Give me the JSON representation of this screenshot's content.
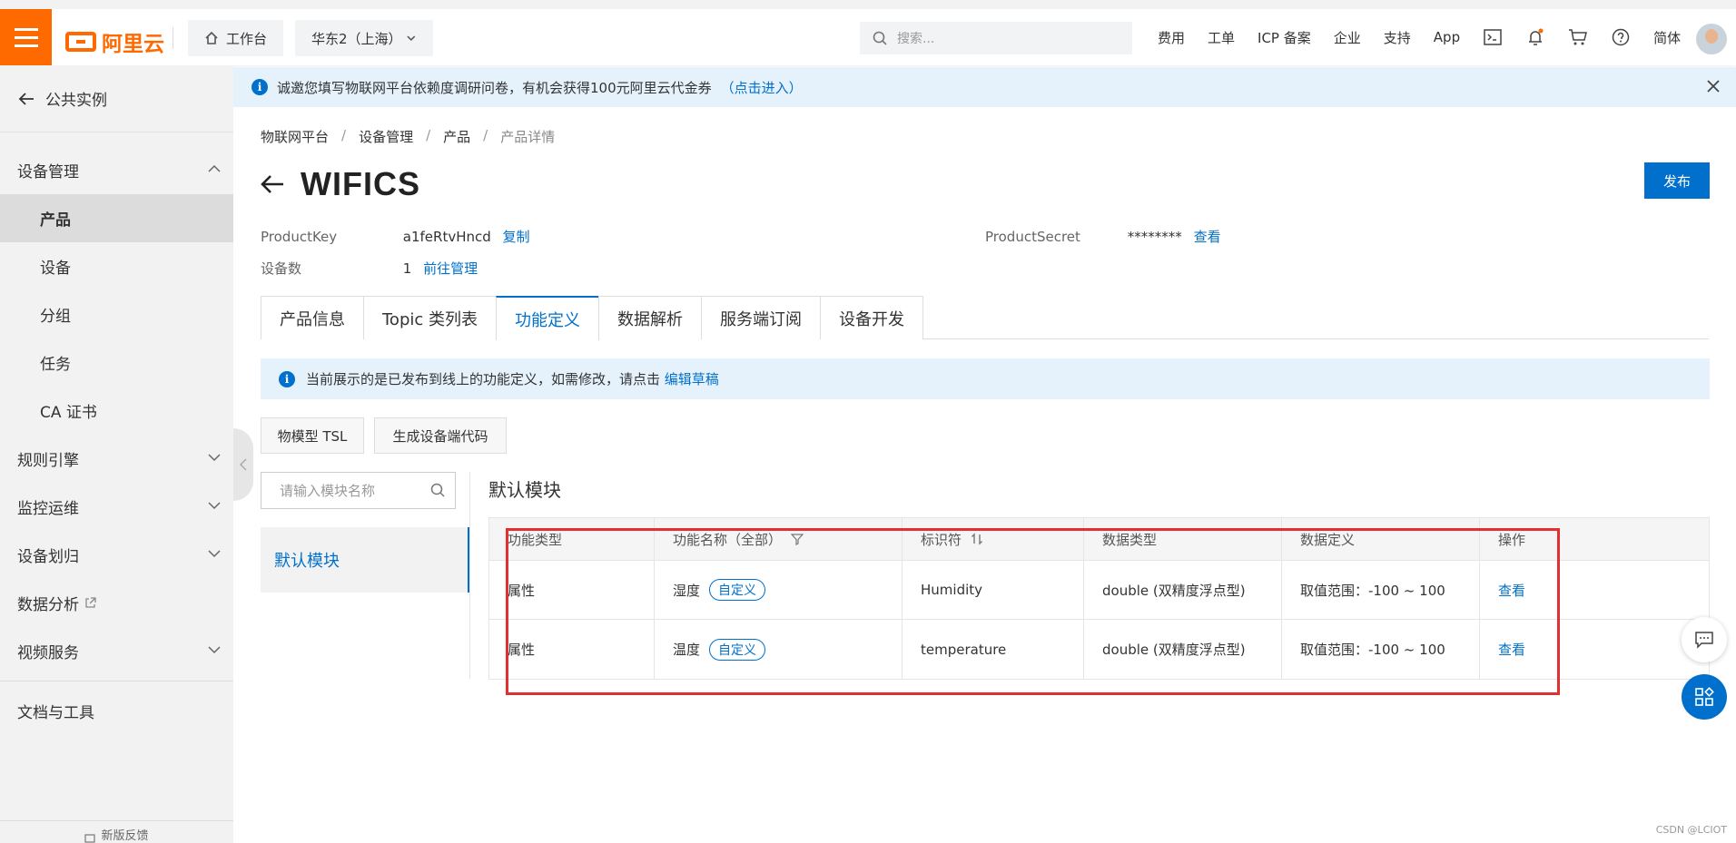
{
  "header": {
    "logo_text": "阿里云",
    "workbench": "工作台",
    "region": "华东2（上海）",
    "search_placeholder": "搜索...",
    "nav": [
      "费用",
      "工单",
      "ICP 备案",
      "企业",
      "支持",
      "App"
    ],
    "lang": "简体"
  },
  "sidebar": {
    "back": "公共实例",
    "items": [
      {
        "label": "设备管理"
      },
      {
        "label": "产品"
      },
      {
        "label": "设备"
      },
      {
        "label": "分组"
      },
      {
        "label": "任务"
      },
      {
        "label": "CA 证书"
      },
      {
        "label": "规则引擎"
      },
      {
        "label": "监控运维"
      },
      {
        "label": "设备划归"
      },
      {
        "label": "数据分析"
      },
      {
        "label": "视频服务"
      },
      {
        "label": "文档与工具"
      }
    ],
    "feedback": "新版反馈"
  },
  "banner": {
    "text": "诚邀您填写物联网平台依赖度调研问卷，有机会获得100元阿里云代金券",
    "link": "（点击进入）"
  },
  "breadcrumb": [
    "物联网平台",
    "设备管理",
    "产品",
    "产品详情"
  ],
  "product": {
    "title": "WIFICS",
    "publish": "发布",
    "key_label": "ProductKey",
    "key_value": "a1feRtvHncd",
    "copy": "复制",
    "secret_label": "ProductSecret",
    "secret_value": "********",
    "view": "查看",
    "devices_label": "设备数",
    "devices_value": "1",
    "manage": "前往管理"
  },
  "tabs": [
    "产品信息",
    "Topic 类列表",
    "功能定义",
    "数据解析",
    "服务端订阅",
    "设备开发"
  ],
  "notice": {
    "text": "当前展示的是已发布到线上的功能定义，如需修改，请点击",
    "link": "编辑草稿"
  },
  "buttons": {
    "tsl": "物模型 TSL",
    "gen": "生成设备端代码"
  },
  "module": {
    "search_placeholder": "请输入模块名称",
    "list_item": "默认模块",
    "title": "默认模块"
  },
  "table": {
    "headers": [
      "功能类型",
      "功能名称（全部）",
      "标识符",
      "数据类型",
      "数据定义",
      "操作"
    ],
    "rows": [
      {
        "type": "属性",
        "name": "湿度",
        "tag": "自定义",
        "id": "Humidity",
        "dtype": "double (双精度浮点型)",
        "def": "取值范围：-100 ~ 100",
        "op": "查看"
      },
      {
        "type": "属性",
        "name": "温度",
        "tag": "自定义",
        "id": "temperature",
        "dtype": "double (双精度浮点型)",
        "def": "取值范围：-100 ~ 100",
        "op": "查看"
      }
    ]
  },
  "watermark": "CSDN @LCIOT",
  "colors": {
    "brand": "#ff6a00",
    "primary": "#0070cc",
    "highlight": "#e03030"
  }
}
